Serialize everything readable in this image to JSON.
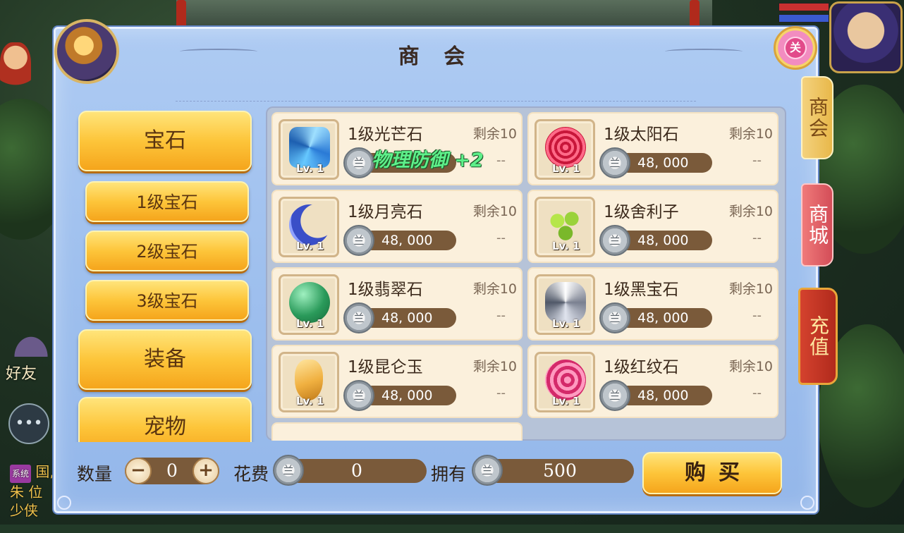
{
  "dialog": {
    "title": "商 会",
    "close_label": "关"
  },
  "side_tabs": {
    "commerce": "商会",
    "mall": "商城",
    "recharge": "充值"
  },
  "categories": [
    {
      "label": "宝石",
      "kind": "main"
    },
    {
      "label": "1级宝石",
      "kind": "sub"
    },
    {
      "label": "2级宝石",
      "kind": "sub"
    },
    {
      "label": "3级宝石",
      "kind": "sub"
    },
    {
      "label": "装备",
      "kind": "main"
    },
    {
      "label": "宠物",
      "kind": "main"
    }
  ],
  "items": [
    {
      "name": "1级光芒石",
      "stock": "剩余10",
      "level": "Lv. 1",
      "price": "",
      "dash": "--",
      "icon": "blue-crystal-gem-icon",
      "color": "#4aa7f0"
    },
    {
      "name": "1级太阳石",
      "stock": "剩余10",
      "level": "Lv. 1",
      "price": "48, 000",
      "dash": "--",
      "icon": "red-spiral-gem-icon",
      "color": "#e8345a"
    },
    {
      "name": "1级月亮石",
      "stock": "剩余10",
      "level": "Lv. 1",
      "price": "48, 000",
      "dash": "--",
      "icon": "blue-crescent-gem-icon",
      "color": "#3a4fc8"
    },
    {
      "name": "1级舍利子",
      "stock": "剩余10",
      "level": "Lv. 1",
      "price": "48, 000",
      "dash": "--",
      "icon": "green-beads-icon",
      "color": "#8ac23a"
    },
    {
      "name": "1级翡翠石",
      "stock": "剩余10",
      "level": "Lv. 1",
      "price": "48, 000",
      "dash": "--",
      "icon": "green-orb-gem-icon",
      "color": "#2a9a5a"
    },
    {
      "name": "1级黑宝石",
      "stock": "剩余10",
      "level": "Lv. 1",
      "price": "48, 000",
      "dash": "--",
      "icon": "silver-diamond-gem-icon",
      "color": "#9aa0b0"
    },
    {
      "name": "1级昆仑玉",
      "stock": "剩余10",
      "level": "Lv. 1",
      "price": "48, 000",
      "dash": "--",
      "icon": "amber-jade-icon",
      "color": "#f0b040"
    },
    {
      "name": "1级红纹石",
      "stock": "剩余10",
      "level": "Lv. 1",
      "price": "48, 000",
      "dash": "--",
      "icon": "pink-swirl-gem-icon",
      "color": "#e0407a"
    }
  ],
  "attr_tooltip": "物理防御 +2",
  "coin_glyph": "兰",
  "footer": {
    "qty_label": "数量",
    "qty_value": "0",
    "minus": "−",
    "plus": "+",
    "cost_label": "花费",
    "cost_value": "0",
    "own_label": "拥有",
    "own_value": "500",
    "buy_label": "购买"
  },
  "hud": {
    "friend_label": "好友",
    "sys_tag": "系统",
    "sys_text": "国, 朱 位少侠"
  },
  "colors": {
    "accent_gold": "#fdc53a",
    "panel_blue": "#9fc0ee",
    "price_brown": "#7a5a3a"
  }
}
